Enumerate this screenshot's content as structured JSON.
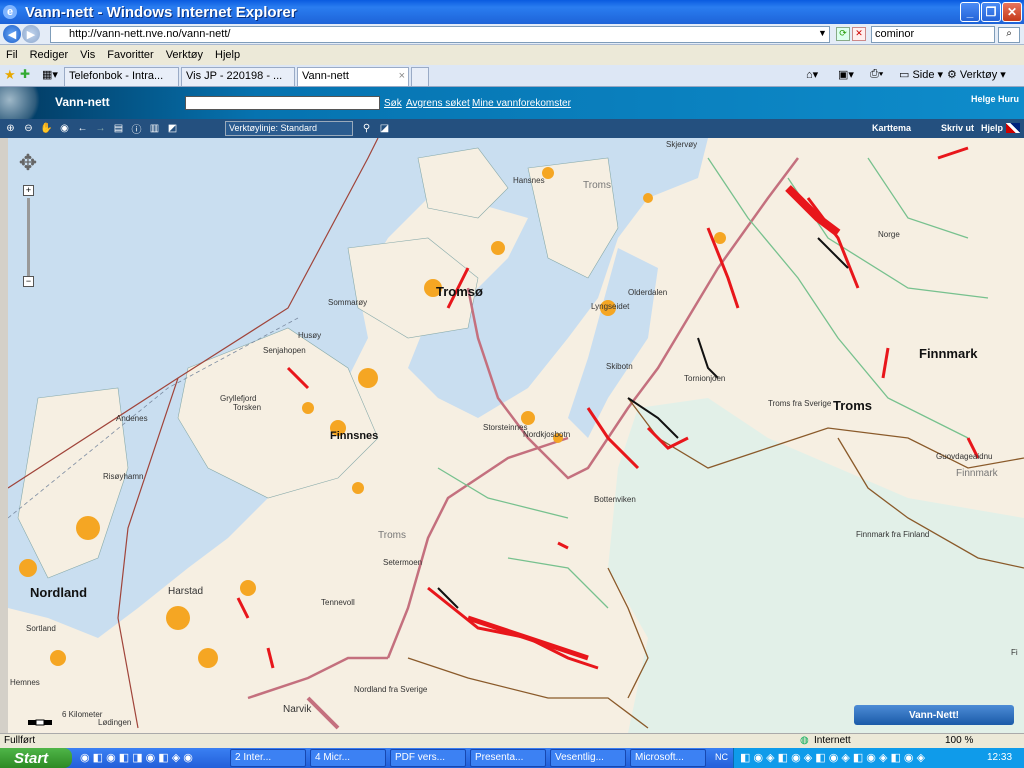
{
  "window": {
    "title": "Vann-nett - Windows Internet Explorer"
  },
  "address": {
    "url": "http://vann-nett.nve.no/vann-nett/",
    "search_value": "cominor"
  },
  "menu": [
    "Fil",
    "Rediger",
    "Vis",
    "Favoritter",
    "Verktøy",
    "Hjelp"
  ],
  "tabs": [
    {
      "label": "Telefonbok - Intra..."
    },
    {
      "label": "Vis JP - 220198 - ..."
    },
    {
      "label": "Vann-nett"
    }
  ],
  "ie_tools": {
    "side": "Side",
    "verktoy": "Verktøy"
  },
  "app": {
    "logo": "Vann-nett",
    "search_link": "Søk",
    "refine_link": "Avgrens søket",
    "my_link": "Mine vannforekomster",
    "user": "Helge Huru",
    "toolbar_select": "Verktøylinje: Standard",
    "karttema": "Karttema",
    "skriv_ut": "Skriv ut",
    "hjelp": "Hjelp",
    "vann_nett_button": "Vann-Nett!"
  },
  "map_labels": {
    "tromso": "Tromsø",
    "finnsnes": "Finnsnes",
    "nordland": "Nordland",
    "finnmark": "Finnmark",
    "troms_region": "Troms",
    "troms_gray": "Troms",
    "troms_gray2": "Troms",
    "harstad": "Harstad",
    "narvik": "Narvik",
    "sommaroy": "Sommarøy",
    "husoy": "Husøy",
    "senjahopen": "Senjahopen",
    "gryllefjord": "Gryllefjord",
    "torsken": "Torsken",
    "andenes": "Andenes",
    "risoyhamn": "Risøyhamn",
    "hansnes": "Hansnes",
    "skjervoy": "Skjervøy",
    "lyngseidet": "Lyngseidet",
    "olderdalen": "Olderdalen",
    "skibotn": "Skibotn",
    "storsteinnes": "Storsteinnes",
    "nordkjosbotn": "Nordkjosbotn",
    "setermoen": "Setermoen",
    "tennevoll": "Tennevoll",
    "hemnes": "Hemnes",
    "lodingen": "Lødingen",
    "norge": "Norge",
    "guovdageaidnu": "Guovdageaidnu",
    "fi": "Fi",
    "finnmark_small": "Finnmark",
    "sortland": "Sortland",
    "scale": "6 Kilometer"
  },
  "border_labels": {
    "tornionjoen": "Tornionjoen",
    "troms_sverige": "Troms fra Sverige",
    "bottenviken": "Bottenviken",
    "finnmark_finland": "Finnmark fra Finland",
    "nordland_sverige": "Nordland fra Sverige"
  },
  "status": {
    "left": "Fullført",
    "zone": "Internett",
    "zoom": "100 %"
  },
  "taskbar": {
    "start": "Start",
    "tasks": [
      "2 Inter...",
      "4 Micr...",
      "PDF vers...",
      "Presenta...",
      "Vesentlig...",
      "Microsoft..."
    ],
    "lang": "NC",
    "time": "12:33"
  },
  "colors": {
    "river_red": "#e8161b",
    "river_orange": "#f5a623",
    "black_river": "#111111",
    "sea": "#c9def0",
    "land": "#f6efe2"
  }
}
